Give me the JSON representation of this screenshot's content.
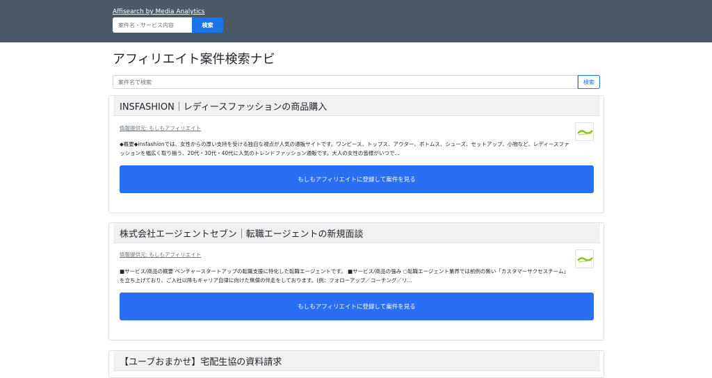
{
  "topbar": {
    "brand": "Affisearch by Media Analytics",
    "search_placeholder": "案件名・サービス内容",
    "search_button": "検索"
  },
  "page": {
    "title": "アフィリエイト案件検索ナビ",
    "search_placeholder": "案件名で検索",
    "search_button": "検索"
  },
  "cards": [
    {
      "title": "INSFASHION｜レディースファッションの商品購入",
      "provider": "情報提供元: もしもアフィリエイト",
      "description": "◆概要◆insfashionでは、女性からの厚い支持を受ける独自な視点が人気の通販サイトです。ワンピース、トップス、アウター、ボトムス、シューズ、セットアップ、小物など、レディースファッションを幅広く取り揃う、20代・30代・40代に人気のトレンドファッション通販です。大人の女性の皆様がいつで…",
      "cta": "もしもアフィリエイトに登録して案件を見る"
    },
    {
      "title": "株式会社エージェントセブン｜転職エージェントの新規面談",
      "provider": "情報提供元: もしもアフィリエイト",
      "description": "■サービス/商品の概要 ベンチャースタートアップの転職支援に特化した転職エージェントです。 ■サービス/商品の強み ○転職エージェント業界では前例の無い「カスタマーサクセスチーム」を立ち上げており、ご入社以降もキャリア自律に向けた無償の伴走をしております。(例：フォローアップ／コーチング／リ…",
      "cta": "もしもアフィリエイトに登録して案件を見る"
    },
    {
      "title": "【ユーブおまかせ】宅配生協の資料請求"
    }
  ],
  "colors": {
    "topbar": "#4a5a66",
    "accent": "#2a6ef3",
    "logo_green": "#8dc21f"
  }
}
